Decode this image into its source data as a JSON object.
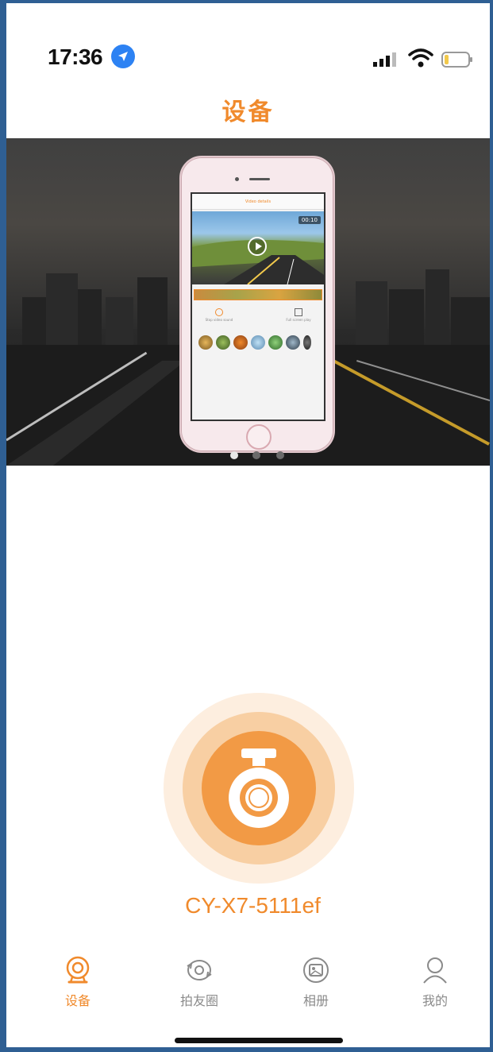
{
  "status_bar": {
    "time": "17:36"
  },
  "header": {
    "title": "设备"
  },
  "banner": {
    "phone_screen_title": "Video details",
    "video_duration": "00:10",
    "option_left": "Stop video sound",
    "option_right": "Full screen play",
    "pagination": {
      "total": 3,
      "active_index": 0
    }
  },
  "device": {
    "name": "CY-X7-5111ef",
    "icon": "dashcam-icon",
    "accent_color": "#f29a45"
  },
  "tab_bar": {
    "tabs": [
      {
        "label": "设备",
        "icon": "device-camera-icon",
        "active": true
      },
      {
        "label": "拍友圈",
        "icon": "moments-icon",
        "active": false
      },
      {
        "label": "相册",
        "icon": "album-icon",
        "active": false
      },
      {
        "label": "我的",
        "icon": "profile-icon",
        "active": false
      }
    ]
  },
  "colors": {
    "accent": "#f08a2c",
    "inactive": "#8a8a8a"
  }
}
